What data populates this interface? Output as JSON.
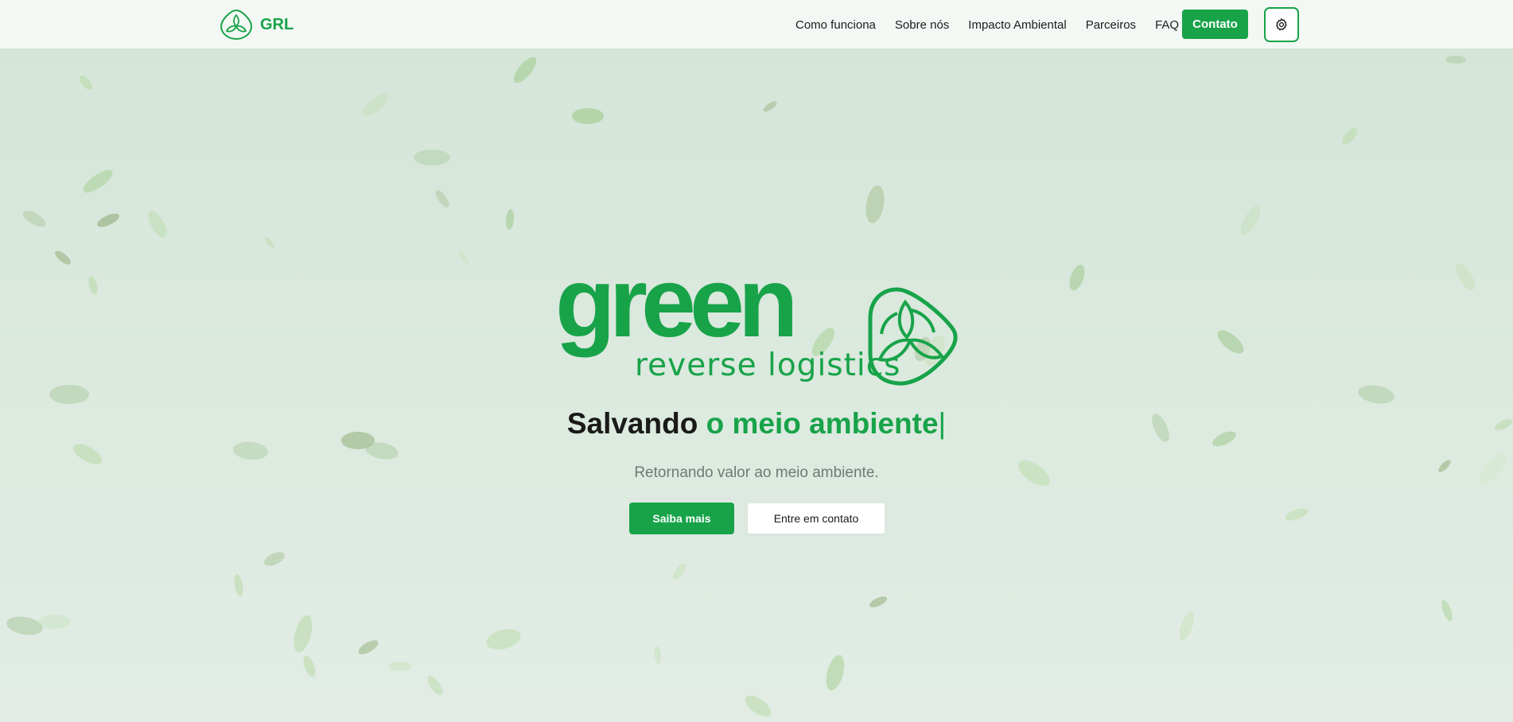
{
  "brand": {
    "name": "GRL",
    "logo_icon": "recycle-leaf-icon"
  },
  "nav": {
    "links": [
      "Como funciona",
      "Sobre nós",
      "Impacto Ambiental",
      "Parceiros",
      "FAQ"
    ],
    "contact_label": "Contato",
    "theme_icon": "gear-icon"
  },
  "hero": {
    "logo_word": "green",
    "logo_subtitle": "reverse logistics",
    "headline_prefix": "Salvando",
    "headline_accent": "o meio ambiente",
    "headline_cursor": "|",
    "tagline": "Retornando valor ao meio ambiente.",
    "primary_button": "Saiba mais",
    "secondary_button": "Entre em contato"
  },
  "colors": {
    "accent": "#18a349",
    "background": "#d4e5d8",
    "navbar": "#f3f8f4",
    "text": "#1a1a1a",
    "muted_text": "#6f7a72"
  }
}
